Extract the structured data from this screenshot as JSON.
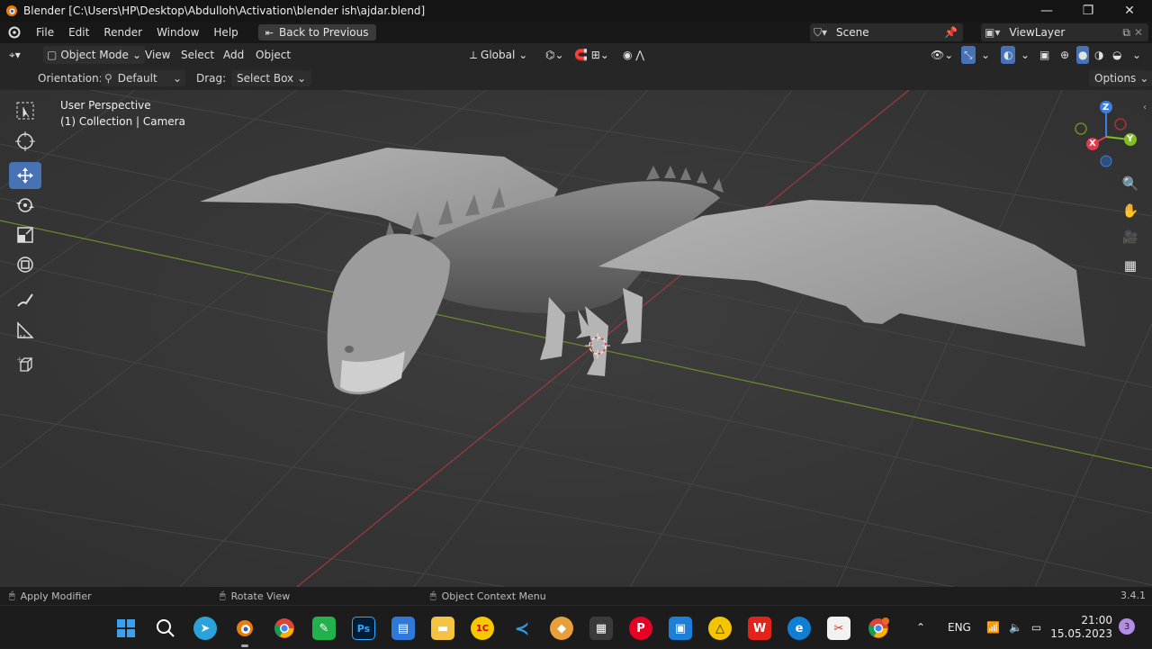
{
  "window": {
    "title": "Blender [C:\\Users\\HP\\Desktop\\Abdulloh\\Activation\\blender ish\\ajdar.blend]",
    "minimize": "—",
    "maximize": "❐",
    "close": "✕"
  },
  "menubar": {
    "items": [
      "File",
      "Edit",
      "Render",
      "Window",
      "Help"
    ],
    "back_button": "Back to Previous",
    "scene_label": "Scene",
    "viewlayer_label": "ViewLayer"
  },
  "header": {
    "mode": "Object Mode",
    "menus": [
      "View",
      "Select",
      "Add",
      "Object"
    ],
    "transform_orientation": "Global",
    "options": "Options"
  },
  "tool_settings": {
    "orientation_label": "Orientation:",
    "orientation_value": "Default",
    "drag_label": "Drag:",
    "drag_value": "Select Box"
  },
  "viewport": {
    "view_name": "User Perspective",
    "collection_info": "(1) Collection | Camera",
    "gizmo_axes": {
      "x": "X",
      "y": "Y",
      "z": "Z"
    }
  },
  "toolbar": {
    "tools": [
      "select-box",
      "cursor",
      "move",
      "rotate",
      "scale",
      "transform",
      "annotate",
      "measure",
      "add-cube"
    ],
    "active": "move"
  },
  "statusbar": {
    "left_hint": "Apply Modifier",
    "middle_hint": "Rotate View",
    "right_hint": "Object Context Menu",
    "version": "3.4.1"
  },
  "taskbar": {
    "apps": [
      "start",
      "search",
      "telegram",
      "blender",
      "chrome",
      "greenapp",
      "photoshop",
      "display",
      "file-explorer",
      "1c",
      "vscode",
      "paint",
      "calculator",
      "pinterest",
      "blue-app",
      "archicad",
      "wps",
      "edge",
      "paint-app",
      "chrome-profile"
    ],
    "language": "ENG",
    "time": "21:00",
    "date": "15.05.2023",
    "notifications": "3"
  },
  "colors": {
    "accent": "#4772b3",
    "axis_x": "#e03c4e",
    "axis_y": "#7fc01f",
    "axis_z": "#3d7fe0",
    "viewport_bg": "#3a3a3a"
  }
}
